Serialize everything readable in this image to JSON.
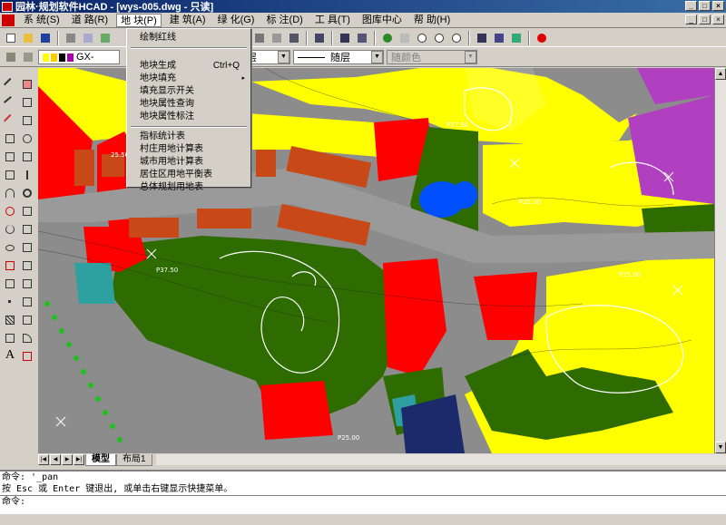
{
  "window": {
    "title": "园林·规划软件HCAD - [wys-005.dwg - 只读]",
    "minimize": "_",
    "maximize": "□",
    "close": "×"
  },
  "menubar": {
    "items": [
      {
        "label": "系  统(S)"
      },
      {
        "label": "道  路(R)"
      },
      {
        "label": "地  块(P)"
      },
      {
        "label": "建  筑(A)"
      },
      {
        "label": "绿  化(G)"
      },
      {
        "label": "标  注(D)"
      },
      {
        "label": "工  具(T)"
      },
      {
        "label": "图库中心"
      },
      {
        "label": "帮  助(H)"
      }
    ]
  },
  "dropdown": {
    "group1": [
      {
        "label": "绘制红线",
        "shortcut": ""
      }
    ],
    "group2": [
      {
        "label": "地块生成",
        "shortcut": "Ctrl+Q"
      },
      {
        "label": "地块填充",
        "shortcut": "",
        "submenu": "▸"
      },
      {
        "label": "填充显示开关",
        "shortcut": ""
      },
      {
        "label": "地块属性查询",
        "shortcut": ""
      },
      {
        "label": "地块属性标注",
        "shortcut": ""
      }
    ],
    "group3": [
      {
        "label": "指标统计表"
      },
      {
        "label": "村庄用地计算表"
      },
      {
        "label": "城市用地计算表"
      },
      {
        "label": "居住区用地平衡表"
      },
      {
        "label": "总体规划用地表"
      }
    ]
  },
  "layer_bar": {
    "layer_name": "GX-",
    "linetype": "随层",
    "lineweight": "随层",
    "color": "随颜色"
  },
  "tabs": [
    {
      "label": "模型"
    },
    {
      "label": "布局1"
    }
  ],
  "command_window": {
    "line1": "命令: '_pan",
    "line2": "按 Esc 或 Enter 键退出, 或单击右键显示快捷菜单。",
    "line3": "命令:"
  },
  "drawing_labels": {
    "l1": "P37.50",
    "l2": "P37.50",
    "l3": "25.50",
    "l4": "P25.00",
    "l5": "P25.00",
    "l6": "P25.00"
  },
  "colors": {
    "residential_red": "#ff0000",
    "green_space": "#2e6b00",
    "commercial_yellow": "#ffff00",
    "purple_area": "#b040c0",
    "water_blue": "#0050ff",
    "road_gray": "#9a9a9a",
    "building_orange": "#c84818"
  }
}
